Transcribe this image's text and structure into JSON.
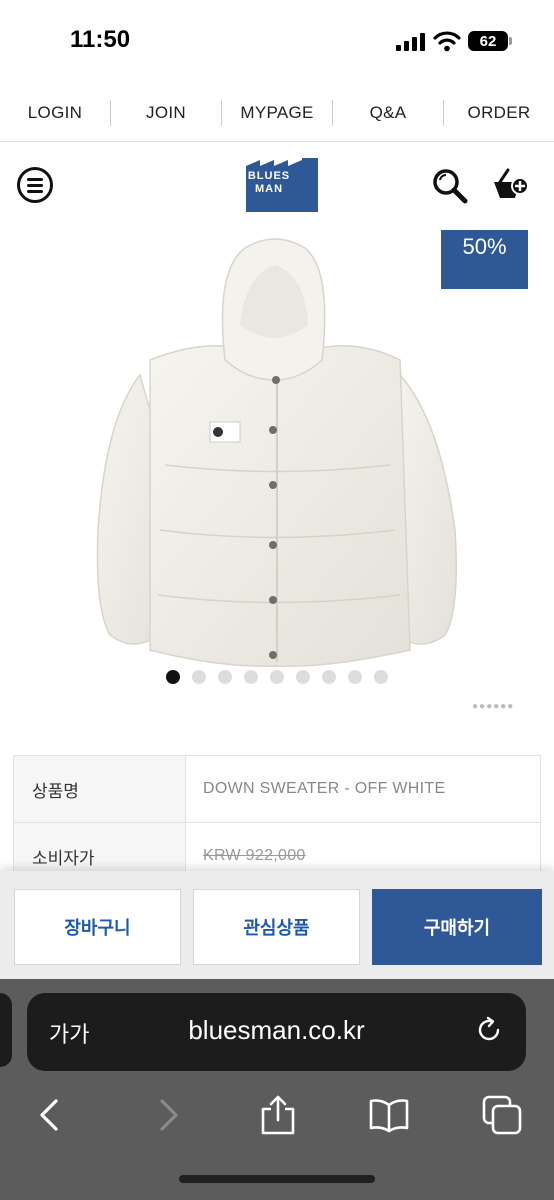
{
  "status_bar": {
    "time": "11:50",
    "battery": "62"
  },
  "top_nav": {
    "items": [
      "LOGIN",
      "JOIN",
      "MYPAGE",
      "Q&A",
      "ORDER"
    ]
  },
  "header": {
    "logo_line1": "BLUES",
    "logo_line2": "MAN"
  },
  "icons": {
    "menu": "menu-icon",
    "search": "search-icon",
    "cart": "cart-add-icon",
    "reload": "reload-icon",
    "back": "chevron-left-icon",
    "forward": "chevron-right-icon",
    "share": "share-icon",
    "bookmarks": "book-icon",
    "tabs": "tabs-icon"
  },
  "product": {
    "discount_badge": "50%",
    "image_count": 9,
    "active_image": 1
  },
  "info": {
    "rows": [
      {
        "label": "상품명",
        "value": "DOWN SWEATER - OFF WHITE"
      },
      {
        "label": "소비자가",
        "value": "KRW 922,000"
      }
    ]
  },
  "actions": {
    "cart": "장바구니",
    "wishlist": "관심상품",
    "buy": "구매하기"
  },
  "browser": {
    "text_size": "가가",
    "url": "bluesman.co.kr"
  },
  "colors": {
    "brand_blue": "#2f5996",
    "link_blue": "#1e5aa8"
  }
}
